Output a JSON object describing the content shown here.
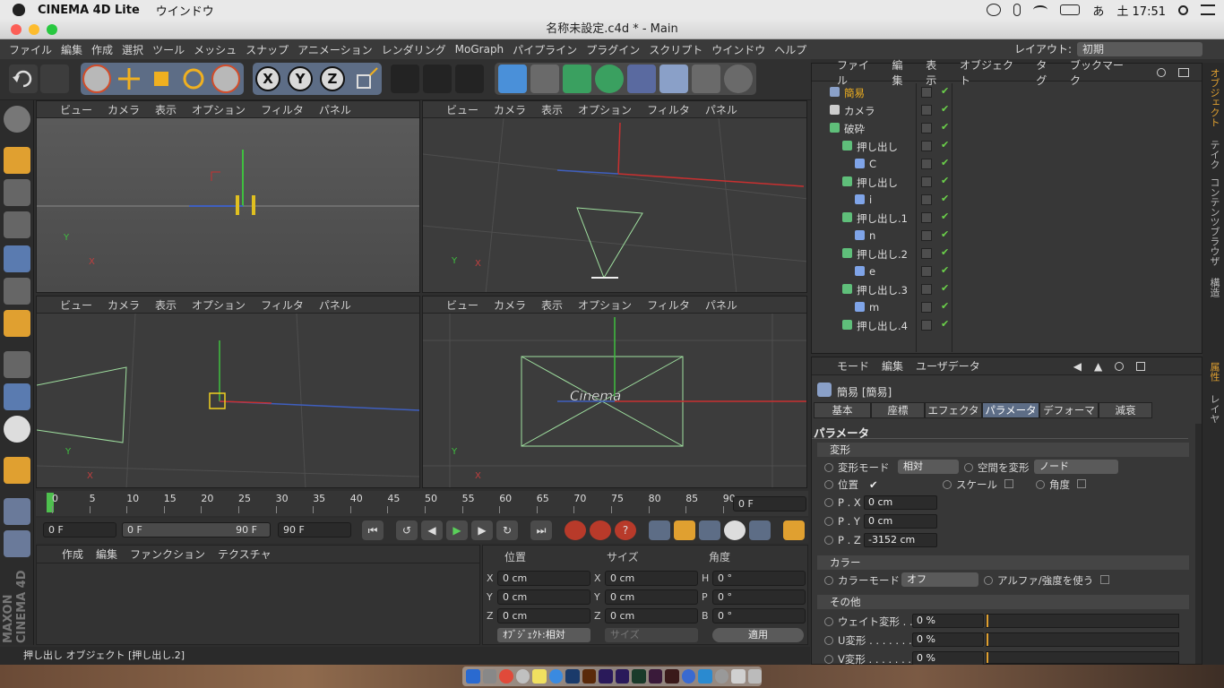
{
  "macbar": {
    "app_name": "CINEMA 4D Lite",
    "menu": "ウインドウ",
    "ime": "あ",
    "clock": "土 17:51"
  },
  "window": {
    "title": "名称未設定.c4d * - Main"
  },
  "menubar": {
    "items": [
      "ファイル",
      "編集",
      "作成",
      "選択",
      "ツール",
      "メッシュ",
      "スナップ",
      "アニメーション",
      "レンダリング",
      "MoGraph",
      "パイプライン",
      "プラグイン",
      "スクリプト",
      "ウインドウ",
      "ヘルプ"
    ],
    "layout_label": "レイアウト:",
    "layout_value": "初期"
  },
  "toolbar": {
    "axis_x": "X",
    "axis_y": "Y",
    "axis_z": "Z"
  },
  "viewport": {
    "menu": [
      "ビュー",
      "カメラ",
      "表示",
      "オプション",
      "フィルタ",
      "パネル"
    ],
    "axis_x": "X",
    "axis_y": "Y",
    "overlay_text": "Cinema"
  },
  "timeline": {
    "ticks": [
      "0",
      "5",
      "10",
      "15",
      "20",
      "25",
      "30",
      "35",
      "40",
      "45",
      "50",
      "55",
      "60",
      "65",
      "70",
      "75",
      "80",
      "85",
      "90"
    ],
    "current_frame": "0 F"
  },
  "transport": {
    "start": "0 F",
    "range_start": "0 F",
    "range_end": "90 F",
    "end": "90 F"
  },
  "material_manager": {
    "menu": [
      "作成",
      "編集",
      "ファンクション",
      "テクスチャ"
    ]
  },
  "coords": {
    "headers": [
      "位置",
      "サイズ",
      "角度"
    ],
    "rows": [
      {
        "a": "X",
        "av": "0 cm",
        "b": "X",
        "bv": "0 cm",
        "c": "H",
        "cv": "0 °"
      },
      {
        "a": "Y",
        "av": "0 cm",
        "b": "Y",
        "bv": "0 cm",
        "c": "P",
        "cv": "0 °"
      },
      {
        "a": "Z",
        "av": "0 cm",
        "b": "Z",
        "bv": "0 cm",
        "c": "B",
        "cv": "0 °"
      }
    ],
    "mode": "ｵﾌﾞｼﾞｪｸﾄ:相対",
    "size_mode": "サイズ",
    "apply": "適用"
  },
  "status": {
    "text": "押し出し オブジェクト [押し出し.2]"
  },
  "object_manager": {
    "menu": [
      "ファイル",
      "編集",
      "表示",
      "オブジェクト",
      "タグ",
      "ブックマーク"
    ],
    "rows": [
      {
        "name": "簡易",
        "indent": 0,
        "color": "#8aa0c8",
        "highlight": true
      },
      {
        "name": "カメラ",
        "indent": 0,
        "color": "#cccccc",
        "highlight": false
      },
      {
        "name": "破砕",
        "indent": 0,
        "color": "#5fbf7a",
        "highlight": false
      },
      {
        "name": "押し出し",
        "indent": 1,
        "color": "#5fbf7a",
        "highlight": false
      },
      {
        "name": "C",
        "indent": 2,
        "color": "#7fa4e8",
        "highlight": false
      },
      {
        "name": "押し出し",
        "indent": 1,
        "color": "#5fbf7a",
        "highlight": false
      },
      {
        "name": "i",
        "indent": 2,
        "color": "#7fa4e8",
        "highlight": false
      },
      {
        "name": "押し出し.1",
        "indent": 1,
        "color": "#5fbf7a",
        "highlight": false
      },
      {
        "name": "n",
        "indent": 2,
        "color": "#7fa4e8",
        "highlight": false
      },
      {
        "name": "押し出し.2",
        "indent": 1,
        "color": "#5fbf7a",
        "highlight": false
      },
      {
        "name": "e",
        "indent": 2,
        "color": "#7fa4e8",
        "highlight": false
      },
      {
        "name": "押し出し.3",
        "indent": 1,
        "color": "#5fbf7a",
        "highlight": false
      },
      {
        "name": "m",
        "indent": 2,
        "color": "#7fa4e8",
        "highlight": false
      },
      {
        "name": "押し出し.4",
        "indent": 1,
        "color": "#5fbf7a",
        "highlight": false
      }
    ]
  },
  "right_tabs": {
    "top": [
      "オブジェクト",
      "テイク",
      "コンテンツブラウザ",
      "構造"
    ],
    "bottom": [
      "属性",
      "レイヤ"
    ]
  },
  "attributes": {
    "menu": [
      "モード",
      "編集",
      "ユーザデータ"
    ],
    "object_title": "簡易 [簡易]",
    "tabs": [
      "基本",
      "座標",
      "エフェクタ",
      "パラメータ",
      "デフォーマ",
      "減衰"
    ],
    "section_title": "パラメータ",
    "deform_section": "変形",
    "deform_mode_label": "変形モード",
    "deform_mode_value": "相対",
    "space_label": "空間を変形",
    "space_value": "ノード",
    "position_label": "位置",
    "scale_label": "スケール",
    "angle_label": "角度",
    "px_label": "P . X",
    "px_value": "0 cm",
    "py_label": "P . Y",
    "py_value": "0 cm",
    "pz_label": "P . Z",
    "pz_value": "-3152 cm",
    "color_section": "カラー",
    "color_mode_label": "カラーモード",
    "color_mode_value": "オフ",
    "alpha_label": "アルファ/強度を使う",
    "other_section": "その他",
    "weight_label": "ウェイト変形 . .",
    "weight_value": "0 %",
    "u_label": "U変形 . . . . . . . .",
    "u_value": "0 %",
    "v_label": "V変形 . . . . . . . .",
    "v_value": "0 %"
  }
}
